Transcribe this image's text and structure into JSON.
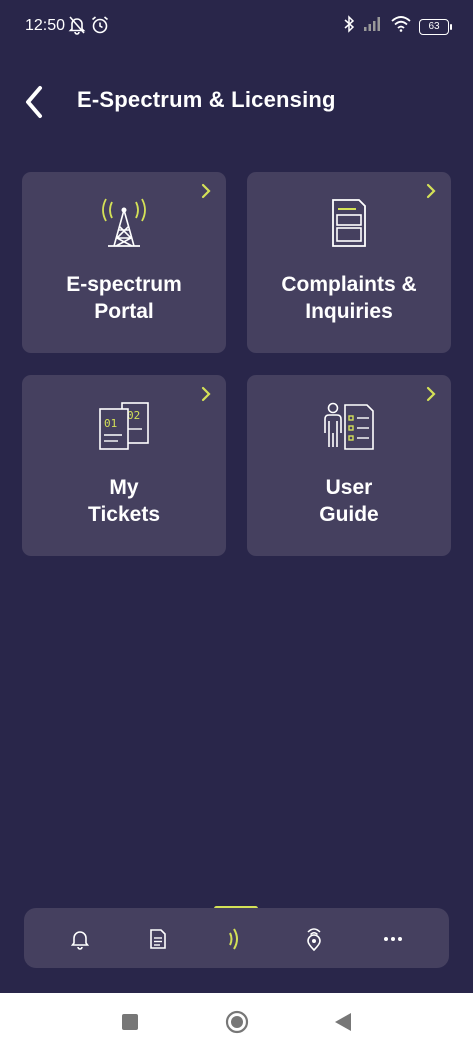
{
  "status_bar": {
    "time": "12:50",
    "battery": "63",
    "icons": [
      "notifications-off-icon",
      "alarm-icon",
      "bluetooth-icon",
      "signal-icon",
      "wifi-icon",
      "battery-icon"
    ]
  },
  "header": {
    "title": "E-Spectrum & Licensing",
    "back_icon": "chevron-left-icon"
  },
  "cards": [
    {
      "line1": "E-spectrum",
      "line2": "Portal",
      "icon": "radio-tower-icon"
    },
    {
      "line1": "Complaints &",
      "line2": "Inquiries",
      "icon": "document-icon"
    },
    {
      "line1": "My",
      "line2": "Tickets",
      "icon": "tickets-icon"
    },
    {
      "line1": "User",
      "line2": "Guide",
      "icon": "user-guide-icon"
    }
  ],
  "bottom_nav": {
    "items": [
      "bell-icon",
      "document-icon",
      "signal-wave-icon",
      "location-signal-icon",
      "more-icon"
    ],
    "active_index": 2
  },
  "system_nav": [
    "recents-square-icon",
    "home-circle-icon",
    "back-triangle-icon"
  ],
  "colors": {
    "background": "#29264a",
    "card": "#45405f",
    "accent": "#d4e157",
    "text": "#ffffff"
  }
}
